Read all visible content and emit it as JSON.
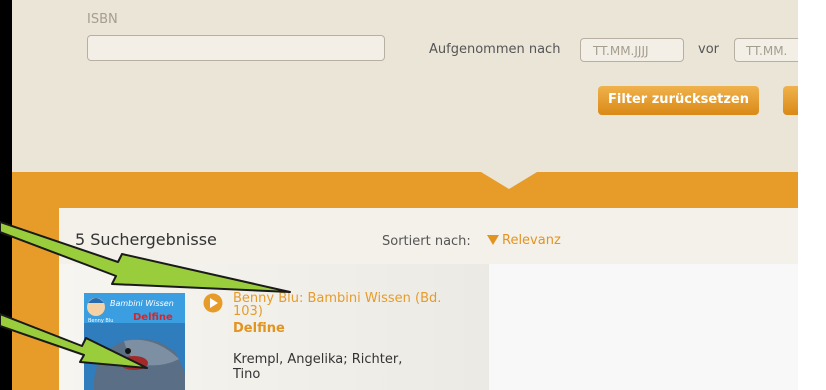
{
  "filters": {
    "isbn_label": "ISBN",
    "isbn_value": "",
    "added_after_label": "Aufgenommen nach",
    "date_from_placeholder": "TT.MM.JJJJ",
    "before_label": "vor",
    "date_to_placeholder": "TT.MM.",
    "reset_button": "Filter zurücksetzen"
  },
  "results": {
    "count_text": "5 Suchergebnisse",
    "sort_label": "Sortiert nach:",
    "sort_value": "Relevanz",
    "items": [
      {
        "title": "Benny Blu: Bambini Wissen (Bd. 103)",
        "subtitle": "Delfine",
        "authors": "Krempl, Angelika; Richter, Tino",
        "cover_series": "Bambini Wissen",
        "cover_title": "Delfine",
        "cover_brand": "Benny Blu"
      }
    ]
  },
  "colors": {
    "accent": "#e79c2a",
    "background": "#ebe5d8",
    "annotation_arrow": "#9acd3c"
  }
}
